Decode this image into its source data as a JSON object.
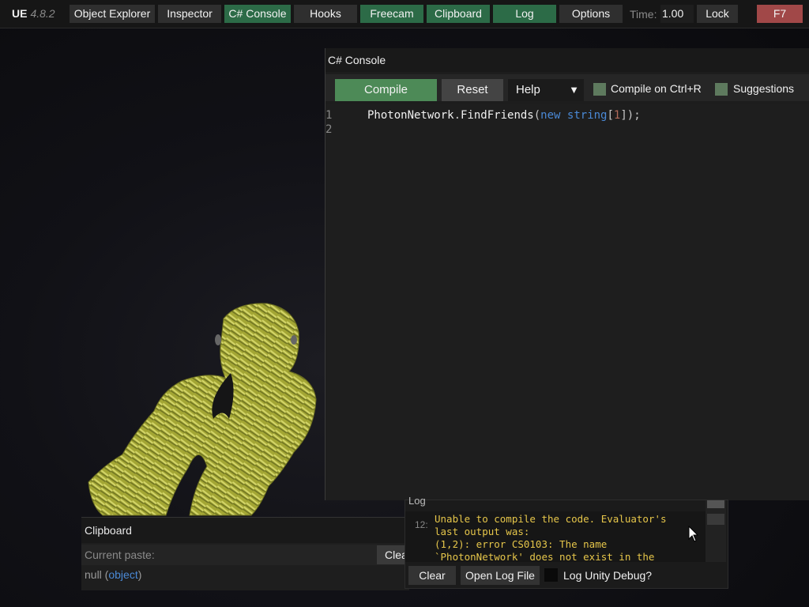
{
  "topbar": {
    "brand": "UE",
    "version": "4.8.2",
    "buttons": [
      "Object Explorer",
      "Inspector",
      "C# Console",
      "Hooks",
      "Freecam",
      "Clipboard",
      "Log",
      "Options"
    ],
    "time_label": "Time:",
    "time_value": "1.00",
    "lock": "Lock",
    "hotkey": "F7"
  },
  "console": {
    "title": "C# Console",
    "compile": "Compile",
    "reset": "Reset",
    "help": "Help",
    "help_arrow": "▼",
    "compile_on_ctrl_r": "Compile on Ctrl+R",
    "suggestions": "Suggestions",
    "lines": [
      "1",
      "2"
    ],
    "code": {
      "ident": "PhotonNetwork",
      "dot": ".",
      "method": "FindFriends",
      "open": "(",
      "kw_new": "new",
      "kw_type": "string",
      "bracket_open": "[",
      "num": "1",
      "bracket_close": "]",
      "close": ");"
    }
  },
  "clipboard": {
    "title": "Clipboard",
    "current_paste": "Current paste:",
    "clear": "Clear",
    "value_null": "null",
    "value_type": "object"
  },
  "log": {
    "title": "Log",
    "entry_index": "12:",
    "entry_text": "Unable to compile the code. Evaluator's\nlast output was:\n(1,2): error CS0103: The name\n`PhotonNetwork' does not exist in the",
    "clear": "Clear",
    "open_log_file": "Open Log File",
    "log_unity_debug": "Log Unity Debug?"
  },
  "colors": {
    "active_tab": "#2c6b47",
    "compile_button": "#4d8a57",
    "hotkey_button": "#a14848",
    "log_text": "#e6c64a",
    "keyword": "#4a89d6"
  }
}
